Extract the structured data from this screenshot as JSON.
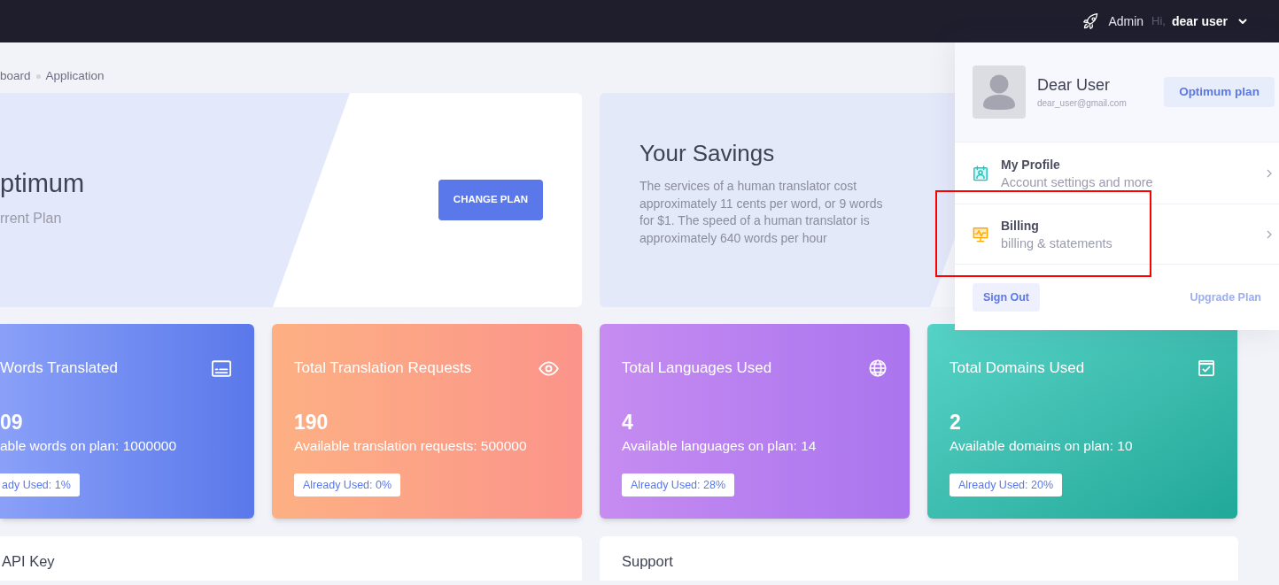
{
  "header": {
    "admin_label": "Admin",
    "user_menu": {
      "greeting": "Hi,",
      "user_name": "dear user",
      "expanded": true
    }
  },
  "breadcrumb": [
    {
      "label": "board"
    },
    {
      "label": "Application"
    }
  ],
  "plan_card": {
    "plan_name": "ptimum",
    "caption": "rrent Plan",
    "button": "CHANGE PLAN"
  },
  "savings_card": {
    "title": "Your Savings",
    "text": "The services of a human translator cost approximately 11 cents per word, or 9 words for $1. The speed of a human translator is approximately 640 words per hour"
  },
  "stats": [
    {
      "title": "Words Translated",
      "value": "09",
      "description": "able words on plan: 1000000",
      "badge": "ady Used: 1%"
    },
    {
      "title": "Total Translation Requests",
      "value": "190",
      "description": "Available translation requests: 500000",
      "badge": "Already Used: 0%"
    },
    {
      "title": "Total Languages Used",
      "value": "4",
      "description": "Available languages on plan: 14",
      "badge": "Already Used: 28%"
    },
    {
      "title": "Total Domains Used",
      "value": "2",
      "description": "Available domains on plan: 10",
      "badge": "Already Used: 20%"
    }
  ],
  "panels": [
    {
      "title": "API Key"
    },
    {
      "title": "Support"
    }
  ],
  "profile_menu": {
    "name": "Dear User",
    "email": "dear_user@gmail.com",
    "plan_button": "Optimum plan",
    "items": [
      {
        "title": "My Profile",
        "subtitle": "Account settings and more",
        "highlighted": false
      },
      {
        "title": "Billing",
        "subtitle": "billing & statements",
        "highlighted": true
      }
    ],
    "sign_out": "Sign Out",
    "upgrade_link": "Upgrade Plan"
  }
}
